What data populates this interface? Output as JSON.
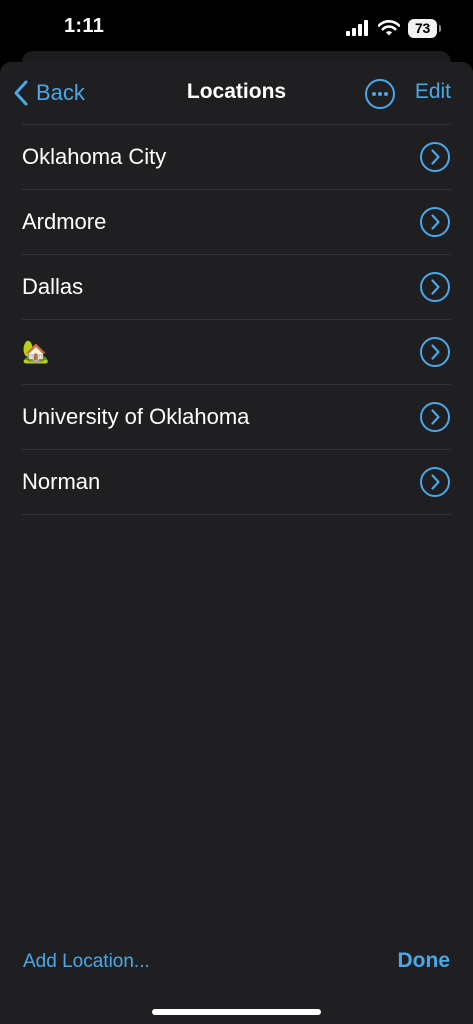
{
  "status_bar": {
    "time": "1:11",
    "battery": "73",
    "icons": [
      "signal-icon",
      "wifi-icon",
      "battery-icon"
    ]
  },
  "nav": {
    "back_label": "Back",
    "title": "Locations",
    "edit_label": "Edit",
    "more_icon": "ellipsis-circle-icon"
  },
  "locations": [
    {
      "label": "Oklahoma City"
    },
    {
      "label": "Ardmore"
    },
    {
      "label": "Dallas"
    },
    {
      "label": "🏡"
    },
    {
      "label": "University of Oklahoma"
    },
    {
      "label": "Norman"
    }
  ],
  "footer": {
    "add_label": "Add Location...",
    "done_label": "Done"
  },
  "colors": {
    "accent": "#4aa8e8",
    "sheet_bg": "#1f1f21",
    "separator": "#333336"
  }
}
